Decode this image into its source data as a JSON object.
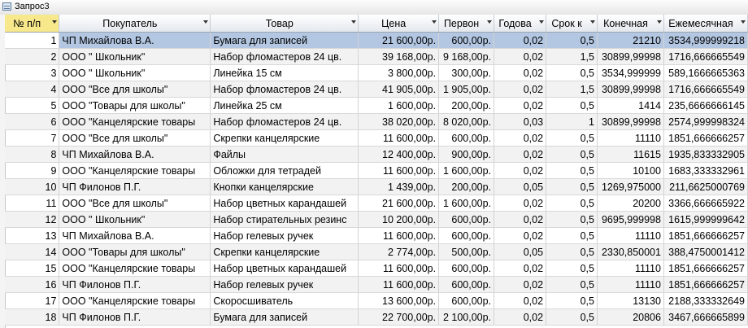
{
  "window": {
    "tab_title": "Запрос3"
  },
  "columns": [
    {
      "key": "n",
      "label": "№ п/п"
    },
    {
      "key": "buyer",
      "label": "Покупатель"
    },
    {
      "key": "item",
      "label": "Товар"
    },
    {
      "key": "price",
      "label": "Цена"
    },
    {
      "key": "first",
      "label": "Первон"
    },
    {
      "key": "annual",
      "label": "Годова"
    },
    {
      "key": "term",
      "label": "Срок к"
    },
    {
      "key": "final",
      "label": "Конечная"
    },
    {
      "key": "monthly",
      "label": "Ежемесячная"
    }
  ],
  "rows": [
    [
      "1",
      "ЧП Михайлова В.А.",
      "Бумага для записей",
      "21 600,00р.",
      "600,00р.",
      "0,02",
      "0,5",
      "21210",
      "3534,999999218"
    ],
    [
      "2",
      "ООО \" Школьник\"",
      "Набор фломастеров 24 цв.",
      "39 168,00р.",
      "9 168,00р.",
      "0,02",
      "1,5",
      "30899,99998",
      "1716,666665549"
    ],
    [
      "3",
      "ООО \" Школьник\"",
      "Линейка 15 см",
      "3 800,00р.",
      "300,00р.",
      "0,02",
      "0,5",
      "3534,999999",
      "589,1666665363"
    ],
    [
      "4",
      "ООО \"Все для школы\"",
      "Набор фломастеров 24 цв.",
      "41 905,00р.",
      "1 905,00р.",
      "0,02",
      "1,5",
      "30899,99998",
      "1716,666665549"
    ],
    [
      "5",
      "ООО \"Товары для школы\"",
      "Линейка 25 см",
      "1 600,00р.",
      "200,00р.",
      "0,02",
      "0,5",
      "1414",
      "235,6666666145"
    ],
    [
      "6",
      "ООО \"Канцелярские товары",
      "Набор фломастеров 24 цв.",
      "38 020,00р.",
      "8 020,00р.",
      "0,03",
      "1",
      "30899,99998",
      "2574,999998324"
    ],
    [
      "7",
      "ООО \"Все для школы\"",
      "Скрепки канцелярские",
      "11 600,00р.",
      "600,00р.",
      "0,02",
      "0,5",
      "11110",
      "1851,666666257"
    ],
    [
      "8",
      "ЧП Михайлова В.А.",
      "Файлы",
      "12 400,00р.",
      "900,00р.",
      "0,02",
      "0,5",
      "11615",
      "1935,833332905"
    ],
    [
      "9",
      "ООО \"Канцелярские товары",
      "Обложки для тетрадей",
      "11 600,00р.",
      "1 600,00р.",
      "0,02",
      "0,5",
      "10100",
      "1683,333332961"
    ],
    [
      "10",
      "ЧП Филонов П.Г.",
      "Кнопки канцелярские",
      "1 439,00р.",
      "200,00р.",
      "0,05",
      "0,5",
      "1269,975000",
      "211,6625000769"
    ],
    [
      "11",
      "ООО \"Все для школы\"",
      "Набор цветных карандашей",
      "21 600,00р.",
      "1 600,00р.",
      "0,02",
      "0,5",
      "20200",
      "3366,666665922"
    ],
    [
      "12",
      "ООО \" Школьник\"",
      "Набор стирательных резинс",
      "10 200,00р.",
      "600,00р.",
      "0,02",
      "0,5",
      "9695,999998",
      "1615,999999642"
    ],
    [
      "13",
      "ЧП Михайлова В.А.",
      "Набор гелевых ручек",
      "11 600,00р.",
      "600,00р.",
      "0,02",
      "0,5",
      "11110",
      "1851,666666257"
    ],
    [
      "14",
      "ООО \"Товары для школы\"",
      "Скрепки канцелярские",
      "2 774,00р.",
      "500,00р.",
      "0,05",
      "0,5",
      "2330,850001",
      "388,4750001412"
    ],
    [
      "15",
      "ООО \"Канцелярские товары",
      "Набор цветных карандашей",
      "11 600,00р.",
      "600,00р.",
      "0,02",
      "0,5",
      "11110",
      "1851,666666257"
    ],
    [
      "16",
      "ЧП Филонов П.Г.",
      "Набор гелевых ручек",
      "11 600,00р.",
      "600,00р.",
      "0,02",
      "0,5",
      "11110",
      "1851,666666257"
    ],
    [
      "17",
      "ООО \"Канцелярские товары",
      "Скоросшиватель",
      "13 600,00р.",
      "600,00р.",
      "0,02",
      "0,5",
      "13130",
      "2188,333332649"
    ],
    [
      "18",
      "ЧП Филонов П.Г.",
      "Бумага для записей",
      "22 700,00р.",
      "2 100,00р.",
      "0,02",
      "0,5",
      "20806",
      "3467,666665899"
    ]
  ],
  "colors": {
    "selected_row": "#b3c7e2",
    "selected_header": "#f7e98b",
    "alt_row": "#f2f2f2"
  }
}
